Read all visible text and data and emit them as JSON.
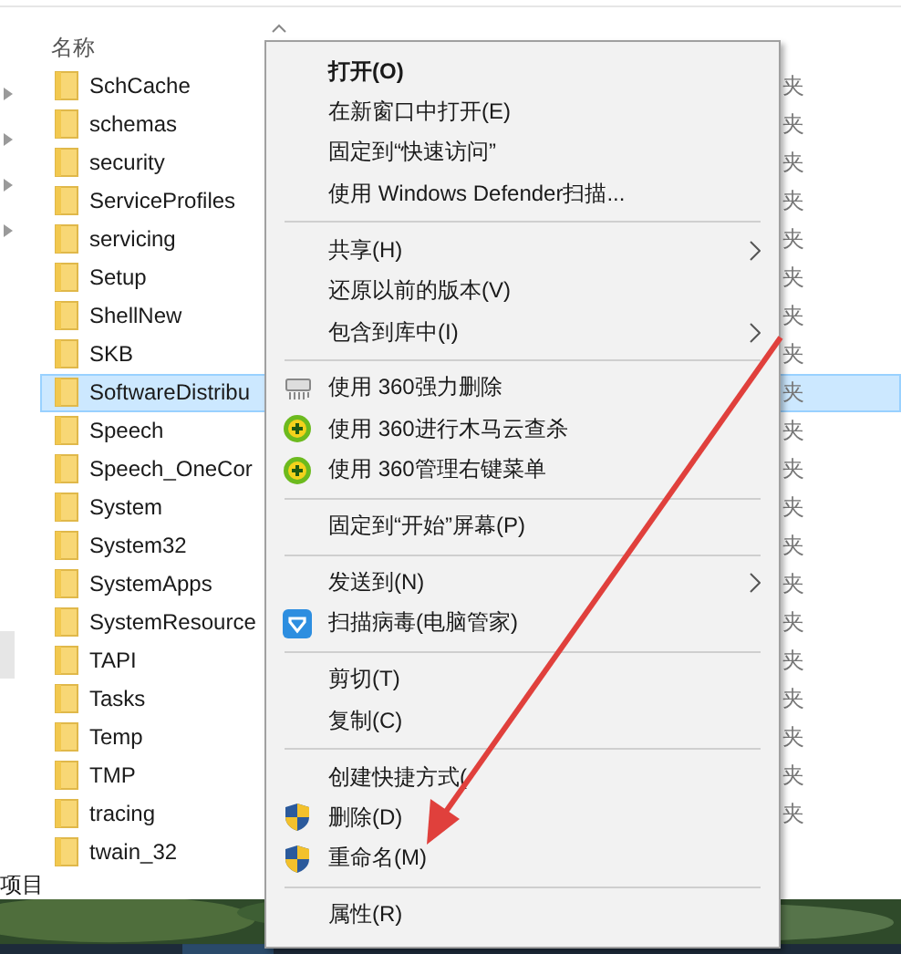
{
  "header": {
    "name_column": "名称"
  },
  "rows": [
    {
      "name": "SchCache",
      "selected": false,
      "type": "夹"
    },
    {
      "name": "schemas",
      "selected": false,
      "type": "夹"
    },
    {
      "name": "security",
      "selected": false,
      "type": "夹"
    },
    {
      "name": "ServiceProfiles",
      "selected": false,
      "type": "夹"
    },
    {
      "name": "servicing",
      "selected": false,
      "type": "夹"
    },
    {
      "name": "Setup",
      "selected": false,
      "type": "夹"
    },
    {
      "name": "ShellNew",
      "selected": false,
      "type": "夹"
    },
    {
      "name": "SKB",
      "selected": false,
      "type": "夹"
    },
    {
      "name": "SoftwareDistribu",
      "selected": true,
      "type": "夹"
    },
    {
      "name": "Speech",
      "selected": false,
      "type": "夹"
    },
    {
      "name": "Speech_OneCor",
      "selected": false,
      "type": "夹"
    },
    {
      "name": "System",
      "selected": false,
      "type": "夹"
    },
    {
      "name": "System32",
      "selected": false,
      "type": "夹"
    },
    {
      "name": "SystemApps",
      "selected": false,
      "type": "夹"
    },
    {
      "name": "SystemResource",
      "selected": false,
      "type": "夹"
    },
    {
      "name": "TAPI",
      "selected": false,
      "type": "夹"
    },
    {
      "name": "Tasks",
      "selected": false,
      "type": "夹"
    },
    {
      "name": "Temp",
      "selected": false,
      "type": "夹"
    },
    {
      "name": "TMP",
      "selected": false,
      "type": "夹"
    },
    {
      "name": "tracing",
      "selected": false,
      "type": "夹"
    },
    {
      "name": "twain_32",
      "selected": false
    }
  ],
  "status_bar": "项目",
  "context_menu": [
    {
      "kind": "plain",
      "label": "打开(O)",
      "default": true,
      "submenu": false
    },
    {
      "kind": "plain",
      "label": "在新窗口中打开(E)",
      "default": false,
      "submenu": false
    },
    {
      "kind": "plain",
      "label": "固定到“快速访问”",
      "default": false,
      "submenu": false
    },
    {
      "kind": "plain",
      "label": "使用 Windows Defender扫描...",
      "default": false,
      "submenu": false
    },
    {
      "kind": "separator"
    },
    {
      "kind": "plain",
      "label": "共享(H)",
      "default": false,
      "submenu": true
    },
    {
      "kind": "plain",
      "label": "还原以前的版本(V)",
      "default": false,
      "submenu": false
    },
    {
      "kind": "plain",
      "label": "包含到库中(I)",
      "default": false,
      "submenu": true
    },
    {
      "kind": "separator"
    },
    {
      "kind": "shredder",
      "label": "使用 360强力删除",
      "default": false,
      "submenu": false
    },
    {
      "kind": "plus",
      "label": "使用 360进行木马云查杀",
      "default": false,
      "submenu": false
    },
    {
      "kind": "plus",
      "label": "使用 360管理右键菜单",
      "default": false,
      "submenu": false
    },
    {
      "kind": "separator"
    },
    {
      "kind": "plain",
      "label": "固定到“开始”屏幕(P)",
      "default": false,
      "submenu": false
    },
    {
      "kind": "separator"
    },
    {
      "kind": "plain",
      "label": "发送到(N)",
      "default": false,
      "submenu": true
    },
    {
      "kind": "scan",
      "label": "扫描病毒(电脑管家)",
      "default": false,
      "submenu": false
    },
    {
      "kind": "separator"
    },
    {
      "kind": "plain",
      "label": "剪切(T)",
      "default": false,
      "submenu": false
    },
    {
      "kind": "plain",
      "label": "复制(C)",
      "default": false,
      "submenu": false
    },
    {
      "kind": "separator"
    },
    {
      "kind": "plain",
      "label": "创建快捷方式(",
      "default": false,
      "submenu": false
    },
    {
      "kind": "shield",
      "label": "删除(D)",
      "default": false,
      "submenu": false
    },
    {
      "kind": "shield",
      "label": "重命名(M)",
      "default": false,
      "submenu": false
    },
    {
      "kind": "separator"
    },
    {
      "kind": "plain",
      "label": "属性(R)",
      "default": false,
      "submenu": false
    }
  ]
}
